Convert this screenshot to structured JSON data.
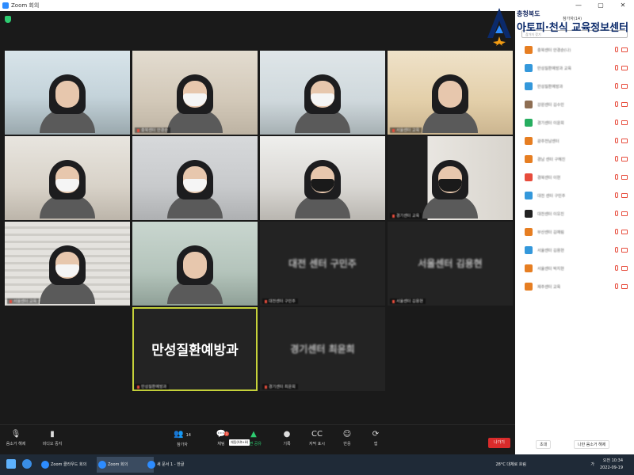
{
  "window": {
    "title": "Zoom 회의",
    "controls": [
      "—",
      "▢",
      "✕"
    ]
  },
  "gallery": [
    {
      "name": "",
      "kind": "video",
      "bg": "bg-a",
      "person": {
        "mask": "none"
      }
    },
    {
      "name": "충북센터 안경순",
      "kind": "video",
      "bg": "bg-b",
      "person": {
        "mask": "white"
      }
    },
    {
      "name": "",
      "kind": "video",
      "bg": "bg-c",
      "person": {
        "mask": "white"
      }
    },
    {
      "name": "서울센터 교육",
      "kind": "video",
      "bg": "bg-d",
      "person": {
        "mask": "none"
      }
    },
    {
      "name": "",
      "kind": "video",
      "bg": "bg-e",
      "person": {
        "mask": "white"
      }
    },
    {
      "name": "",
      "kind": "video",
      "bg": "bg-f",
      "person": {
        "mask": "white"
      }
    },
    {
      "name": "",
      "kind": "video",
      "bg": "bg-g",
      "person": {
        "mask": "dark"
      }
    },
    {
      "name": "경기센터 교육",
      "kind": "video",
      "bg": "bg-h",
      "person": {
        "mask": "dark"
      }
    },
    {
      "name": "서울센터 교육",
      "kind": "video",
      "bg": "bg-i",
      "person": {
        "mask": "white"
      }
    },
    {
      "name": "",
      "kind": "video",
      "bg": "bg-j",
      "person": {
        "mask": "none"
      }
    },
    {
      "name": "대전센터 구민주",
      "kind": "text",
      "text": "대전 센터 구민주",
      "blurred": true
    },
    {
      "name": "서울센터 김용현",
      "kind": "text",
      "text": "서울센터 김용현",
      "blurred": true
    },
    {
      "name": "만성질환예방과",
      "kind": "text",
      "text": "만성질환예방과",
      "blurred": false,
      "active": true
    },
    {
      "name": "경기센터 최윤희",
      "kind": "text",
      "text": "경기센터 최윤희",
      "blurred": true
    }
  ],
  "controls": {
    "mute": "음소거 해제",
    "video": "비디오 중지",
    "participants": "참가자",
    "participants_count": "14",
    "chat": "채팅",
    "chat_badge": "1",
    "share": "화면 공유",
    "record": "기록",
    "captions": "자막 표시",
    "reactions": "반응",
    "apps": "앱",
    "leave": "나가기",
    "tooltip": "채팅(Alt+H)"
  },
  "panel": {
    "title": "참가자(14)",
    "search_placeholder": "참가자 찾기",
    "participants": [
      {
        "name": "충북센터 안경순(나)",
        "color": "#e67e22"
      },
      {
        "name": "만성질환예방과 교육",
        "color": "#3498db"
      },
      {
        "name": "만성질환예방과",
        "color": "#3498db"
      },
      {
        "name": "강원센터 김수민",
        "color": "#8e6e53"
      },
      {
        "name": "경기센터 이윤희",
        "color": "#27ae60"
      },
      {
        "name": "광주전남센터",
        "color": "#e67e22"
      },
      {
        "name": "경남 센터 구혜진",
        "color": "#e67e22"
      },
      {
        "name": "경북센터 이현",
        "color": "#e74c3c"
      },
      {
        "name": "대전 센터 구민주",
        "color": "#3498db"
      },
      {
        "name": "대전센터 이유진",
        "color": "#222222"
      },
      {
        "name": "부산센터 김예림",
        "color": "#e67e22"
      },
      {
        "name": "서울센터 김용현",
        "color": "#3498db"
      },
      {
        "name": "서울센터 박지현",
        "color": "#e67e22"
      },
      {
        "name": "제주센터 교육",
        "color": "#e67e22"
      }
    ],
    "invite": "초대",
    "mute_all": "나만 음소거 해제"
  },
  "overlay": {
    "line1": "충청북도",
    "line2": "아토피·천식 교육정보센터",
    "brand_color": "#0b2a6b",
    "accent_color": "#f39c12"
  },
  "taskbar": {
    "apps": [
      {
        "label": "Zoom 클라우드 회의",
        "active": false
      },
      {
        "label": "Zoom 회의",
        "active": true
      },
      {
        "label": "새 문서 1 - 한글",
        "active": false
      }
    ],
    "weather": "28°C 대체로 흐림",
    "lang": "가",
    "time": "오전 10:34",
    "date": "2022-09-19"
  }
}
